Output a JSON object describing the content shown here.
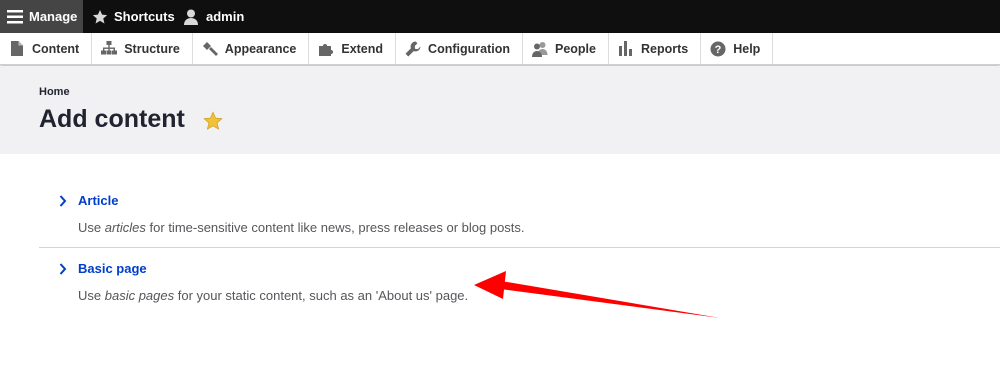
{
  "toolbar": {
    "manage_label": "Manage",
    "shortcuts_label": "Shortcuts",
    "user_label": "admin"
  },
  "tray": {
    "items": [
      {
        "label": "Content",
        "icon": "document-icon"
      },
      {
        "label": "Structure",
        "icon": "sitemap-icon"
      },
      {
        "label": "Appearance",
        "icon": "paintbrush-icon"
      },
      {
        "label": "Extend",
        "icon": "puzzle-icon"
      },
      {
        "label": "Configuration",
        "icon": "wrench-icon"
      },
      {
        "label": "People",
        "icon": "people-icon"
      },
      {
        "label": "Reports",
        "icon": "bar-chart-icon"
      },
      {
        "label": "Help",
        "icon": "help-icon"
      }
    ]
  },
  "header": {
    "breadcrumb": "Home",
    "title": "Add content"
  },
  "content_types": [
    {
      "label": "Article",
      "desc_prefix": "Use ",
      "desc_em": "articles",
      "desc_suffix": " for time-sensitive content like news, press releases or blog posts."
    },
    {
      "label": "Basic page",
      "desc_prefix": "Use ",
      "desc_em": "basic pages",
      "desc_suffix": " for your static content, such as an 'About us' page."
    }
  ],
  "colors": {
    "toolbar_bg": "#0f0f0f",
    "manage_bg": "#454545",
    "header_bg": "#f1f1f4",
    "link": "#003ecc",
    "star": "#f0c23a",
    "annotation_arrow": "#ff0000"
  }
}
